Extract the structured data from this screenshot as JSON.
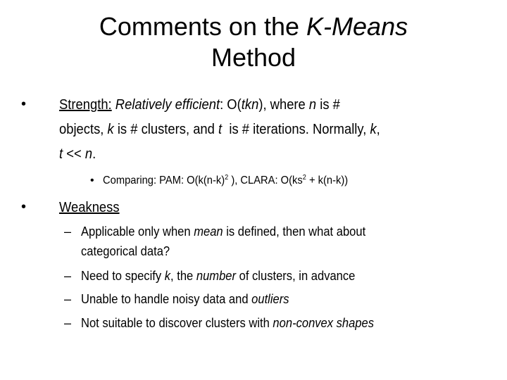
{
  "slide": {
    "title": {
      "line1_prefix": "Comments on the ",
      "line1_italic": "K-Means",
      "line2": "Method"
    },
    "bullets": [
      {
        "marker": "•",
        "label": "Strength:",
        "line1": {
          "italic1": "Relatively efficient",
          "text1": ": O(",
          "italic2": "tkn",
          "text2": "), where ",
          "italic3": "n",
          "text3": " is #"
        },
        "line2": {
          "text1": "objects, ",
          "italic1": "k",
          "text2": " is # clusters, and ",
          "italic2": "t",
          "text3": "  is # iterations. Normally, ",
          "italic3": "k",
          "text4": ","
        },
        "line3": {
          "italic1": "t",
          "text1": " << ",
          "italic2": "n",
          "text2": "."
        },
        "sub": {
          "marker": "•",
          "text1": "Comparing: PAM: O(k(n-k)",
          "sup1": "2",
          "text2": " ), CLARA: O(ks",
          "sup2": "2",
          "text3": " + k(n-k))"
        }
      },
      {
        "marker": "•",
        "label": "Weakness",
        "items": [
          {
            "marker": "–",
            "text1": "Applicable only when ",
            "italic1": "mean",
            "text2": " is defined, then what about",
            "line2": "categorical data?"
          },
          {
            "marker": "–",
            "text1": "Need to specify ",
            "italic1": "k",
            "text2": ", the ",
            "italic2": "number",
            "text3": " of clusters, in advance"
          },
          {
            "marker": "–",
            "text1": "Unable to handle noisy data and ",
            "italic1": "outliers"
          },
          {
            "marker": "–",
            "text1": "Not suitable to discover clusters with ",
            "italic1": "non-convex shapes"
          }
        ]
      }
    ]
  }
}
